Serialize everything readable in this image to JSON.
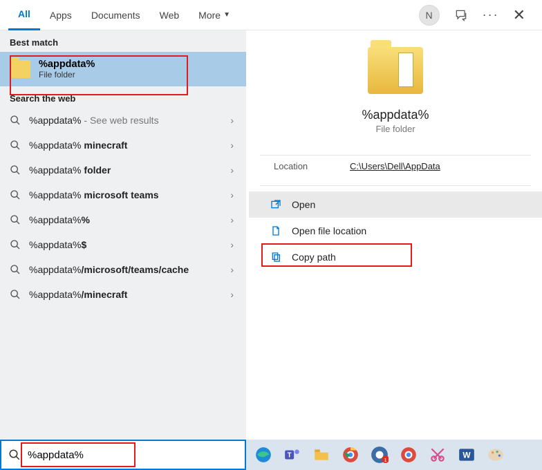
{
  "tabs": {
    "all": "All",
    "apps": "Apps",
    "documents": "Documents",
    "web": "Web",
    "more": "More"
  },
  "avatar_initial": "N",
  "left": {
    "best_label": "Best match",
    "best": {
      "title": "%appdata%",
      "subtitle": "File folder"
    },
    "web_label": "Search the web",
    "items": [
      {
        "pre": "%appdata%",
        "bold": "",
        "suffix": " - See web results"
      },
      {
        "pre": "%appdata%",
        "bold": " minecraft",
        "suffix": ""
      },
      {
        "pre": "%appdata%",
        "bold": " folder",
        "suffix": ""
      },
      {
        "pre": "%appdata%",
        "bold": " microsoft teams",
        "suffix": ""
      },
      {
        "pre": "%appdata%",
        "bold": "%",
        "suffix": ""
      },
      {
        "pre": "%appdata%",
        "bold": "$",
        "suffix": ""
      },
      {
        "pre": "%appdata%",
        "bold": "/microsoft/teams/cache",
        "suffix": ""
      },
      {
        "pre": "%appdata%",
        "bold": "/minecraft",
        "suffix": ""
      }
    ]
  },
  "preview": {
    "title": "%appdata%",
    "subtitle": "File folder",
    "location_label": "Location",
    "location_value": "C:\\Users\\Dell\\AppData",
    "actions": {
      "open": "Open",
      "open_loc": "Open file location",
      "copy": "Copy path"
    }
  },
  "search": {
    "query": "%appdata%"
  }
}
